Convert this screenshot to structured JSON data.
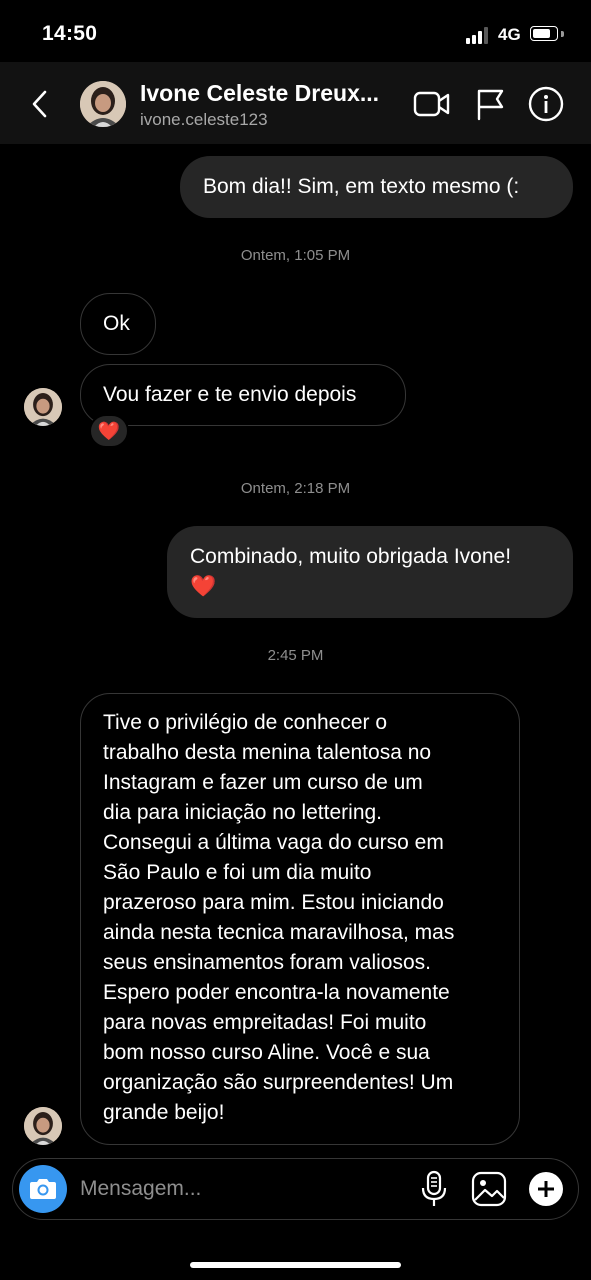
{
  "status_bar": {
    "time": "14:50",
    "network": "4G"
  },
  "header": {
    "name": "Ivone Celeste Dreux...",
    "username": "ivone.celeste123"
  },
  "messages": {
    "out1": "Bom dia!! Sim, em texto mesmo (:",
    "ts1": "Ontem, 1:05 PM",
    "in1": "Ok",
    "in2": "Vou fazer e te envio depois",
    "reaction": "❤️",
    "ts2": "Ontem, 2:18 PM",
    "out2_line1": "Combinado, muito obrigada Ivone!",
    "out2_line2": "❤️",
    "ts3": "2:45 PM",
    "in3_lines": [
      "Tive o privilégio de conhecer o",
      "trabalho desta menina talentosa no",
      "Instagram e fazer um curso de um",
      "dia para iniciação no lettering.",
      "Consegui a última vaga do curso em",
      "São Paulo e foi um dia muito",
      "prazeroso para mim. Estou iniciando",
      "ainda nesta tecnica maravilhosa, mas",
      "seus ensinamentos foram valiosos.",
      "Espero poder encontra-la novamente",
      "para novas empreitadas! Foi muito",
      "bom nosso curso Aline. Você e sua",
      "organização são surpreendentes! Um",
      "grande beijo!"
    ]
  },
  "composer": {
    "placeholder": "Mensagem..."
  },
  "icons": [
    "back-icon",
    "video-call-icon",
    "flag-icon",
    "info-icon",
    "camera-icon",
    "microphone-icon",
    "gallery-icon",
    "plus-icon"
  ],
  "colors": {
    "background": "#000000",
    "header": "#121212",
    "bubble_out": "#262626",
    "accent": "#3797f0"
  }
}
